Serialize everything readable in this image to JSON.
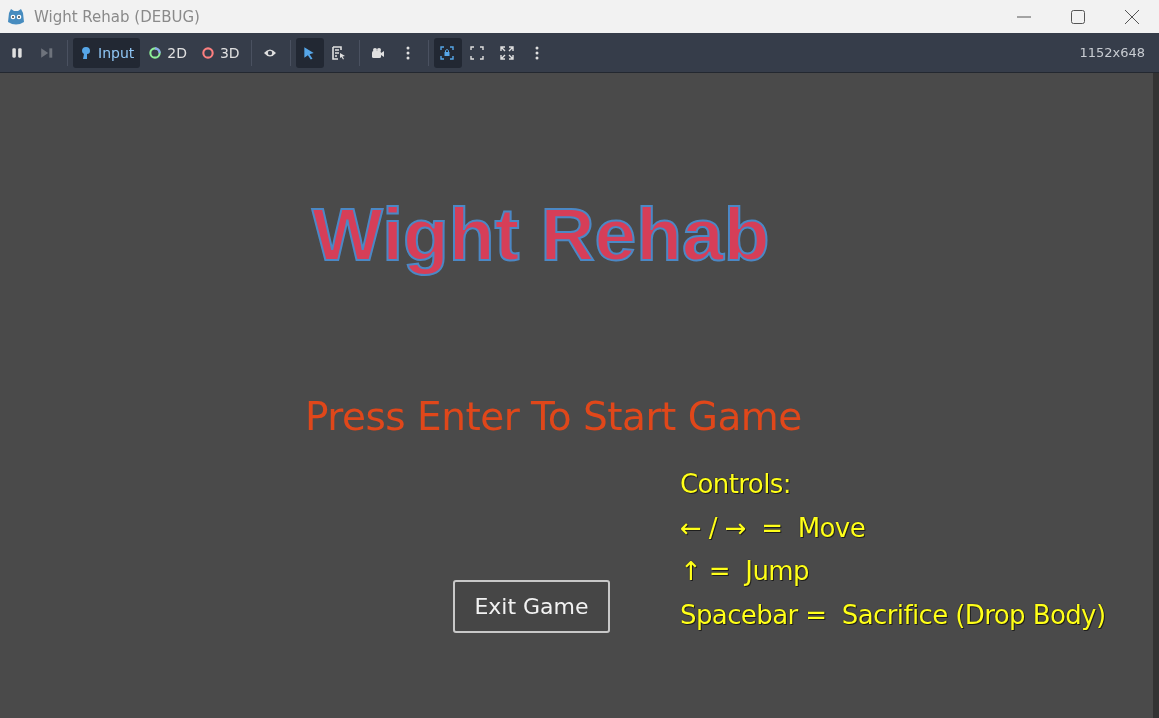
{
  "window": {
    "title": "Wight Rehab (DEBUG)"
  },
  "toolbar": {
    "groups": [
      [
        {
          "kind": "pause",
          "selected": false,
          "disabled": false
        },
        {
          "kind": "step",
          "selected": false,
          "disabled": true
        }
      ],
      [
        {
          "kind": "input",
          "label": "Input",
          "selected": true,
          "disabled": false
        },
        {
          "kind": "planar",
          "label": "2D",
          "selected": false,
          "disabled": false
        },
        {
          "kind": "spatial",
          "label": "3D",
          "selected": false,
          "disabled": false
        }
      ],
      [
        {
          "kind": "eye",
          "selected": false,
          "disabled": false
        }
      ],
      [
        {
          "kind": "select",
          "selected": true,
          "disabled": false
        },
        {
          "kind": "list-select",
          "selected": false,
          "disabled": false
        }
      ],
      [
        {
          "kind": "camera",
          "selected": false,
          "disabled": false
        },
        {
          "kind": "more",
          "selected": false,
          "disabled": false
        }
      ],
      [
        {
          "kind": "camera-lock",
          "selected": true,
          "disabled": false
        },
        {
          "kind": "shrink",
          "selected": false,
          "disabled": false
        },
        {
          "kind": "expand",
          "selected": false,
          "disabled": false
        },
        {
          "kind": "more",
          "selected": false,
          "disabled": false
        }
      ]
    ],
    "resolution": "1152x648"
  },
  "game": {
    "title": "Wight Rehab",
    "prompt": "Press Enter To Start Game",
    "exit_button": "Exit Game",
    "controls": [
      "Controls:",
      "← / →  =  Move",
      "↑ =  Jump",
      "Spacebar =  Sacrifice (Drop Body)"
    ]
  }
}
